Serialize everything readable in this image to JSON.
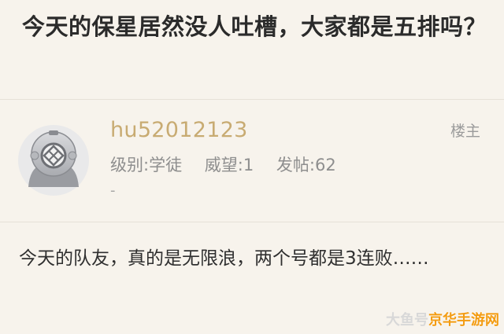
{
  "thread": {
    "title": "今天的保星居然没人吐槽，大家都是五排吗？"
  },
  "post": {
    "username": "hu52012123",
    "floor_label": "楼主",
    "level": "级别:学徒",
    "prestige": "威望:1",
    "post_count": "发帖:62",
    "extra": "-",
    "body": "今天的队友，真的是无限浪，两个号都是3连败……"
  },
  "watermark": {
    "part_a": "大鱼号",
    "part_b": "京华手游网"
  },
  "colors": {
    "background": "#f7f3ec",
    "username": "#c8ab72",
    "title": "#2b2b2b",
    "meta": "#8e8e8e",
    "watermark_accent": "#f39c12"
  },
  "icons": {
    "avatar": "diving-helmet-avatar-icon"
  }
}
